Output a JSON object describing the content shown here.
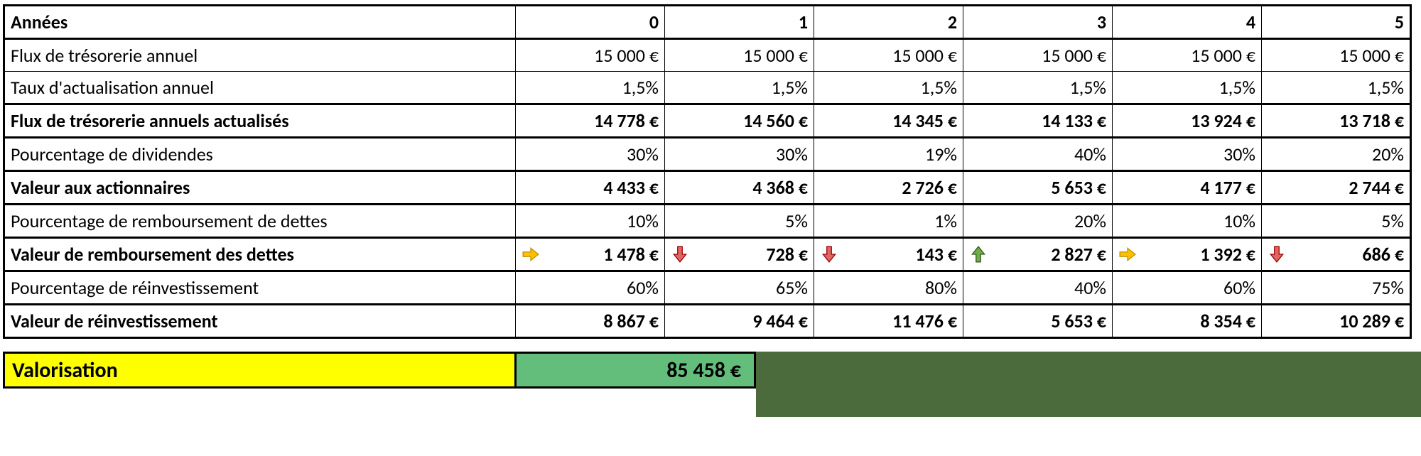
{
  "rows": {
    "years": {
      "label": "Années",
      "values": [
        "0",
        "1",
        "2",
        "3",
        "4",
        "5"
      ],
      "bold": true
    },
    "cashflow": {
      "label": "Flux de trésorerie annuel",
      "values": [
        "15 000 €",
        "15 000 €",
        "15 000 €",
        "15 000 €",
        "15 000 €",
        "15 000 €"
      ]
    },
    "discount": {
      "label": "Taux d'actualisation annuel",
      "values": [
        "1,5%",
        "1,5%",
        "1,5%",
        "1,5%",
        "1,5%",
        "1,5%"
      ]
    },
    "discflow": {
      "label": "Flux de trésorerie annuels actualisés",
      "values": [
        "14 778 €",
        "14 560 €",
        "14 345 €",
        "14 133 €",
        "13 924 €",
        "13 718 €"
      ],
      "bold": true
    },
    "divpct": {
      "label": "Pourcentage de dividendes",
      "values": [
        "30%",
        "30%",
        "19%",
        "40%",
        "30%",
        "20%"
      ]
    },
    "shareval": {
      "label": "Valeur aux actionnaires",
      "values": [
        "4 433 €",
        "4 368 €",
        "2 726 €",
        "5 653 €",
        "4 177 €",
        "2 744 €"
      ],
      "bold": true
    },
    "debtpct": {
      "label": "Pourcentage de remboursement de dettes",
      "values": [
        "10%",
        "5%",
        "1%",
        "20%",
        "10%",
        "5%"
      ]
    },
    "debtval": {
      "label": "Valeur de remboursement des dettes",
      "values": [
        "1 478 €",
        "728 €",
        "143 €",
        "2 827 €",
        "1 392 €",
        "686 €"
      ],
      "bold": true,
      "icons": [
        "right",
        "down",
        "down",
        "up",
        "right",
        "down"
      ]
    },
    "reinvpct": {
      "label": "Pourcentage de réinvestissement",
      "values": [
        "60%",
        "65%",
        "80%",
        "40%",
        "60%",
        "75%"
      ]
    },
    "reinvval": {
      "label": "Valeur de réinvestissement",
      "values": [
        "8 867 €",
        "9 464 €",
        "11 476 €",
        "5 653 €",
        "8 354 €",
        "10 289 €"
      ],
      "bold": true
    }
  },
  "valorisation": {
    "label": "Valorisation",
    "value": "85 458 €"
  },
  "chart_data": {
    "type": "table",
    "title": "Discounted cash-flow valuation model",
    "years": [
      0,
      1,
      2,
      3,
      4,
      5
    ],
    "annual_cash_flow_eur": [
      15000,
      15000,
      15000,
      15000,
      15000,
      15000
    ],
    "discount_rate_pct": [
      1.5,
      1.5,
      1.5,
      1.5,
      1.5,
      1.5
    ],
    "discounted_cash_flow_eur": [
      14778,
      14560,
      14345,
      14133,
      13924,
      13718
    ],
    "dividend_pct": [
      30,
      30,
      19,
      40,
      30,
      20
    ],
    "shareholder_value_eur": [
      4433,
      4368,
      2726,
      5653,
      4177,
      2744
    ],
    "debt_repayment_pct": [
      10,
      5,
      1,
      20,
      10,
      5
    ],
    "debt_repayment_value_eur": [
      1478,
      728,
      143,
      2827,
      1392,
      686
    ],
    "debt_trend": [
      "flat",
      "down",
      "down",
      "up",
      "flat",
      "down"
    ],
    "reinvestment_pct": [
      60,
      65,
      80,
      40,
      60,
      75
    ],
    "reinvestment_value_eur": [
      8867,
      9464,
      11476,
      5653,
      8354,
      10289
    ],
    "valuation_total_eur": 85458
  }
}
